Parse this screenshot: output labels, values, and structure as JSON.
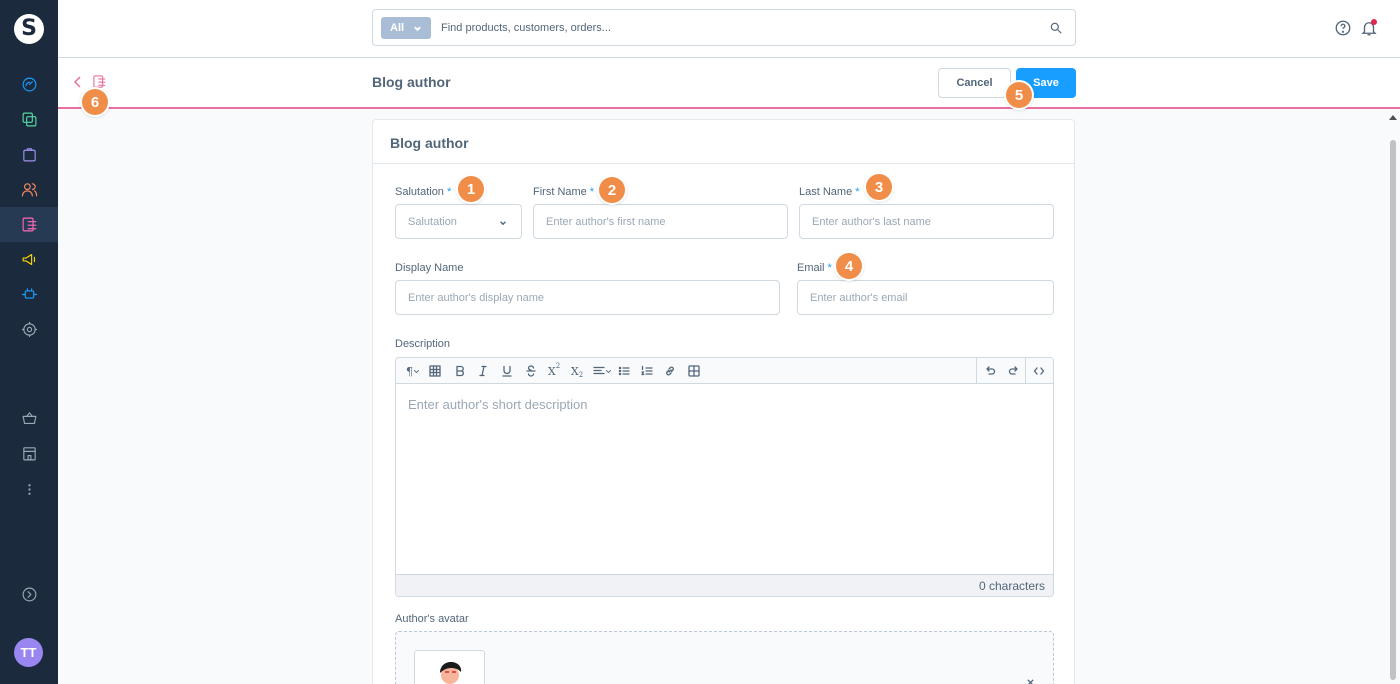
{
  "search": {
    "type_label": "All",
    "placeholder": "Find products, customers, orders..."
  },
  "smartbar": {
    "title": "Blog author",
    "cancel_label": "Cancel",
    "save_label": "Save"
  },
  "card": {
    "title": "Blog author"
  },
  "fields": {
    "salutation": {
      "label": "Salutation",
      "placeholder": "Salutation"
    },
    "first_name": {
      "label": "First Name",
      "placeholder": "Enter author's first name"
    },
    "last_name": {
      "label": "Last Name",
      "placeholder": "Enter author's last name"
    },
    "display_name": {
      "label": "Display Name",
      "placeholder": "Enter author's display name"
    },
    "email": {
      "label": "Email",
      "placeholder": "Enter author's email"
    },
    "description": {
      "label": "Description",
      "placeholder": "Enter author's short description",
      "char_count": "0 characters"
    },
    "avatar": {
      "label": "Author's avatar"
    }
  },
  "required_marker": "*",
  "badges": [
    "1",
    "2",
    "3",
    "4",
    "5",
    "6"
  ],
  "user": {
    "initials": "TT"
  },
  "sidebar": {
    "items": [
      {
        "icon": "dashboard-icon",
        "color": "#189eff"
      },
      {
        "icon": "catalog-icon",
        "color": "#57d9a3"
      },
      {
        "icon": "orders-icon",
        "color": "#a092f0"
      },
      {
        "icon": "customers-icon",
        "color": "#f88962"
      },
      {
        "icon": "content-icon",
        "color": "#ff68b4",
        "active": true
      },
      {
        "icon": "marketing-icon",
        "color": "#ffd700"
      },
      {
        "icon": "extensions-icon",
        "color": "#189eff"
      },
      {
        "icon": "settings-icon",
        "color": "#9aa8b5"
      },
      {
        "icon": "sales-channel-icon",
        "color": "#9aa8b5"
      },
      {
        "icon": "storefront-icon",
        "color": "#9aa8b5"
      },
      {
        "icon": "more-icon",
        "color": "#9aa8b5"
      },
      {
        "icon": "collapse-icon",
        "color": "#9aa8b5"
      }
    ]
  },
  "colors": {
    "primary": "#189eff",
    "content_accent": "#e8709f",
    "badge": "#ef8d49",
    "sidebar_bg": "#1b2b3d"
  }
}
